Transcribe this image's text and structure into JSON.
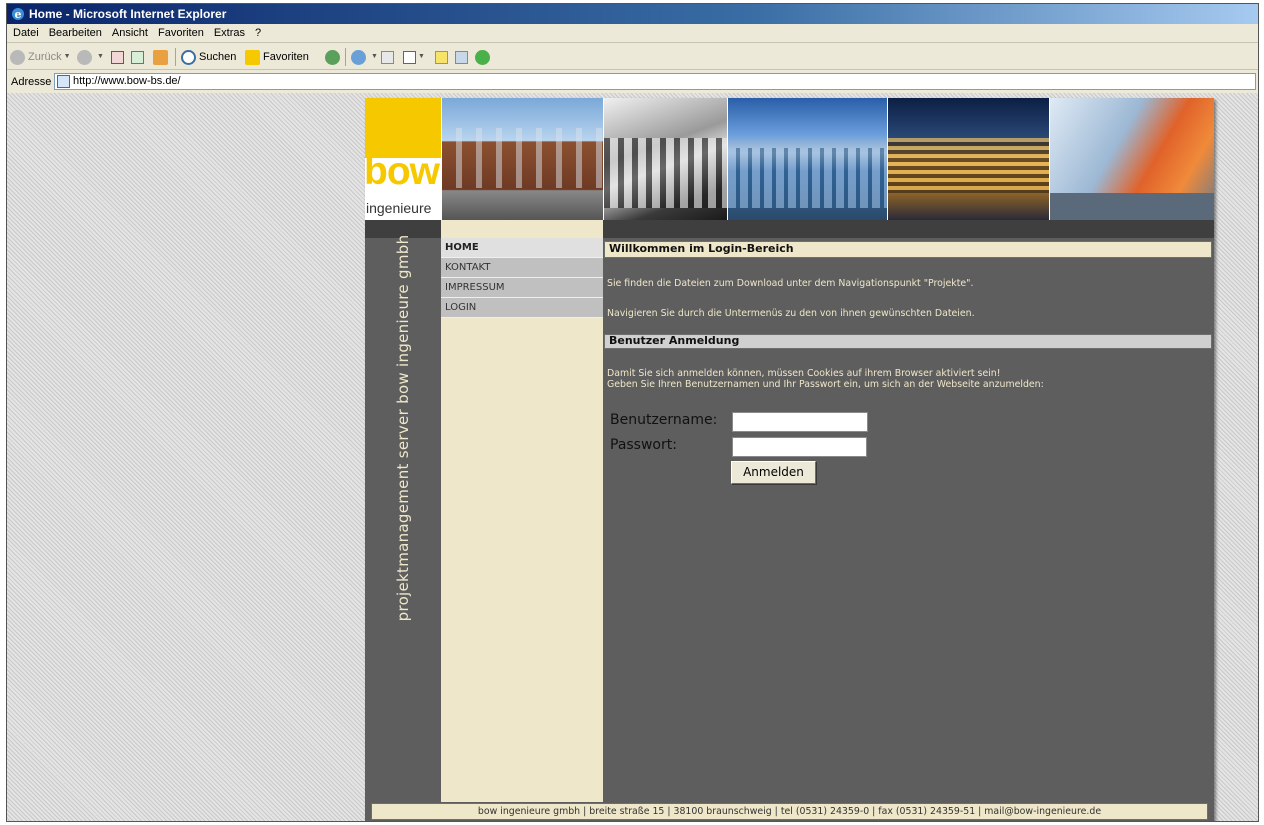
{
  "window": {
    "title": "Home - Microsoft Internet Explorer"
  },
  "menu": {
    "items": [
      "Datei",
      "Bearbeiten",
      "Ansicht",
      "Favoriten",
      "Extras",
      "?"
    ]
  },
  "toolbar": {
    "back_label": "Zurück",
    "search_label": "Suchen",
    "favorites_label": "Favoriten"
  },
  "address": {
    "label": "Adresse",
    "url": "http://www.bow-bs.de/"
  },
  "site": {
    "logo": {
      "word": "bow",
      "sub": "ingenieure"
    },
    "vertical_tagline": "projektmanagement server bow ingenieure gmbh",
    "nav": [
      {
        "label": "HOME",
        "active": true
      },
      {
        "label": "KONTAKT",
        "active": false
      },
      {
        "label": "IMPRESSUM",
        "active": false
      },
      {
        "label": "LOGIN",
        "active": false
      }
    ],
    "welcome_heading": "Willkommen im Login-Bereich",
    "intro_line_1": "Sie finden die Dateien zum Download unter dem Navigationspunkt \"Projekte\".",
    "intro_line_2": "Navigieren Sie durch die Untermenüs zu den von ihnen gewünschten Dateien.",
    "login_heading": "Benutzer Anmeldung",
    "login_note_1": "Damit Sie sich anmelden können, müssen Cookies auf ihrem Browser aktiviert sein!",
    "login_note_2": "Geben Sie Ihren Benutzernamen und Ihr Passwort ein, um sich an der Webseite anzumelden:",
    "form": {
      "username_label": "Benutzername:",
      "password_label": "Passwort:",
      "username_value": "",
      "password_value": "",
      "submit_label": "Anmelden"
    },
    "footer": "bow ingenieure gmbh | breite straße 15 | 38100 braunschweig | tel (0531) 24359-0 | fax (0531) 24359-51 | mail@bow-ingenieure.de"
  },
  "colors": {
    "brand_yellow": "#f5c800",
    "cream": "#efe7c9",
    "dark_gray": "#5e5e5e"
  }
}
